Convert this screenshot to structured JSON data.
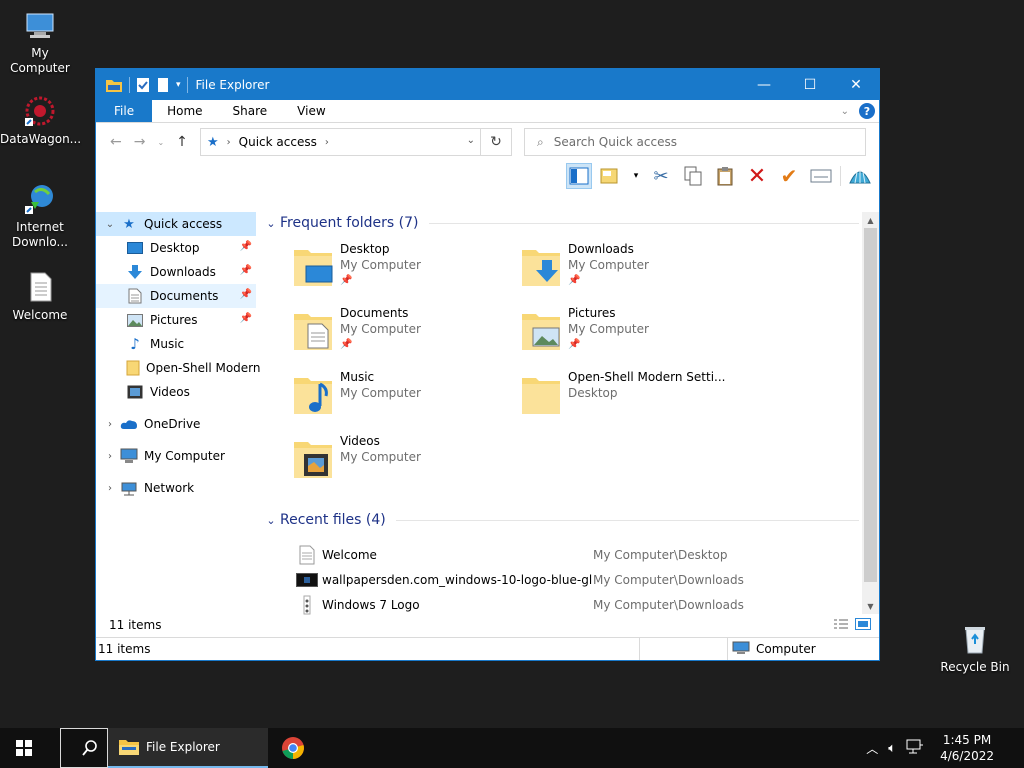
{
  "desktop": {
    "icons": [
      {
        "label": "My Computer"
      },
      {
        "label": "DataWagon..."
      },
      {
        "label": "Internet Downlo..."
      },
      {
        "label": "Welcome"
      },
      {
        "label": "Recycle Bin"
      }
    ]
  },
  "window": {
    "title": "File Explorer",
    "ribbon_tabs": [
      "File",
      "Home",
      "Share",
      "View"
    ],
    "address": {
      "crumb": "Quick access"
    },
    "search_placeholder": "Search Quick access",
    "nav_pane": {
      "quick_access": "Quick access",
      "pinned": [
        "Desktop",
        "Downloads",
        "Documents",
        "Pictures",
        "Music",
        "Open-Shell Modern",
        "Videos"
      ],
      "onedrive": "OneDrive",
      "my_computer": "My Computer",
      "network": "Network"
    },
    "frequent": {
      "heading": "Frequent folders (7)",
      "folders": [
        {
          "name": "Desktop",
          "sub": "My Computer"
        },
        {
          "name": "Downloads",
          "sub": "My Computer"
        },
        {
          "name": "Documents",
          "sub": "My Computer"
        },
        {
          "name": "Pictures",
          "sub": "My Computer"
        },
        {
          "name": "Music",
          "sub": "My Computer"
        },
        {
          "name": "Open-Shell Modern Setti...",
          "sub": "Desktop"
        },
        {
          "name": "Videos",
          "sub": "My Computer"
        }
      ]
    },
    "recent": {
      "heading": "Recent files (4)",
      "files": [
        {
          "name": "Welcome",
          "path": "My Computer\\Desktop"
        },
        {
          "name": "wallpapersden.com_windows-10-logo-blue-gl...",
          "path": "My Computer\\Downloads"
        },
        {
          "name": "Windows 7 Logo",
          "path": "My Computer\\Downloads"
        }
      ]
    },
    "inner_status": "11 items",
    "outer_status": {
      "items": "11 items",
      "location": "Computer"
    }
  },
  "taskbar": {
    "fe_label": "File Explorer",
    "time": "1:45 PM",
    "date": "4/6/2022"
  },
  "colors": {
    "accent": "#1979ca",
    "selection": "#cce8ff",
    "heading": "#1e3287"
  }
}
